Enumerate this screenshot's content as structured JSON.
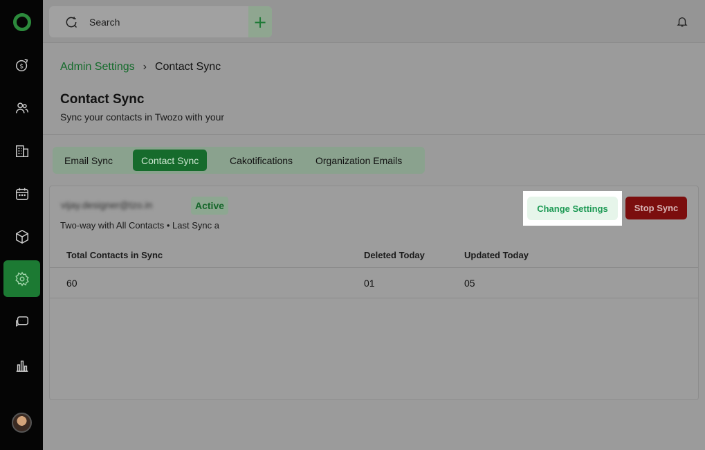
{
  "sidebar": {
    "items": [
      {
        "name": "deals-icon"
      },
      {
        "name": "contacts-icon"
      },
      {
        "name": "companies-icon"
      },
      {
        "name": "calendar-icon"
      },
      {
        "name": "products-icon"
      },
      {
        "name": "settings-icon",
        "active": true
      },
      {
        "name": "chat-icon"
      },
      {
        "name": "reports-icon"
      }
    ]
  },
  "topbar": {
    "search_label": "Search",
    "add_label": "+"
  },
  "breadcrumb": {
    "parent": "Admin Settings",
    "separator": "›",
    "current": "Contact Sync"
  },
  "page": {
    "title": "Contact Sync",
    "subtitle": "Sync your contacts in Twozo with your"
  },
  "tabs": [
    {
      "label": "Email Sync"
    },
    {
      "label": "Contact Sync",
      "active": true
    },
    {
      "label": "Cakotifications"
    },
    {
      "label": "Organization Emails"
    }
  ],
  "sync_account": {
    "email": "vijay.designer@tzo.in",
    "status": "Active",
    "meta": "Two-way with All Contacts  •  Last Sync a",
    "change_settings_label": "Change Settings",
    "stop_sync_label": "Stop Sync"
  },
  "table": {
    "headers": [
      "Total Contacts in Sync",
      "Deleted Today",
      "Updated Today"
    ],
    "rows": [
      [
        "60",
        "01",
        "05"
      ]
    ]
  },
  "colors": {
    "accent_green": "#166b2c",
    "stop_red": "#7b0e0e",
    "change_text": "#1e9a55"
  }
}
